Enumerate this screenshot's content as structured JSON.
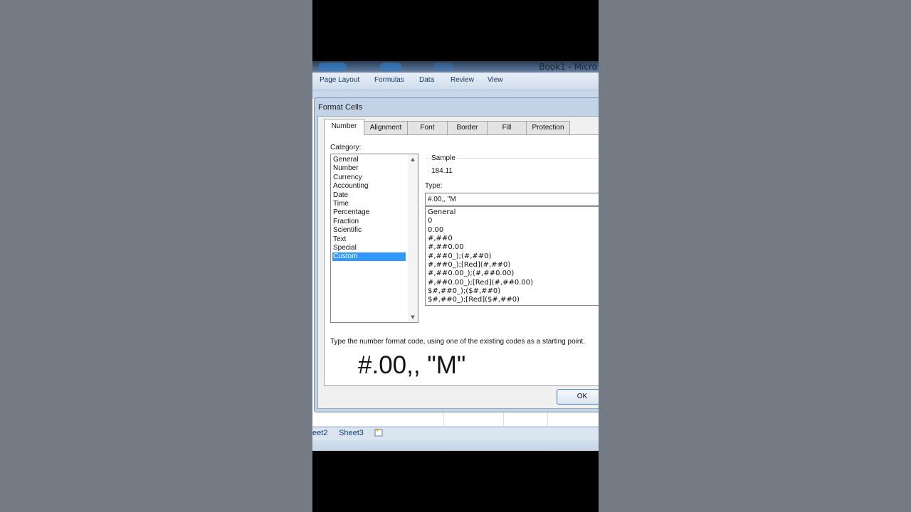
{
  "window": {
    "title": "Book1 - Micro"
  },
  "ribbon": {
    "tabs": [
      "Page Layout",
      "Formulas",
      "Data",
      "Review",
      "View"
    ]
  },
  "sheet_tabs": [
    "eet2",
    "Sheet3"
  ],
  "dialog": {
    "title": "Format Cells",
    "tabs": [
      "Number",
      "Alignment",
      "Font",
      "Border",
      "Fill",
      "Protection"
    ],
    "active_tab": "Number",
    "category_label": "Category:",
    "categories": [
      "General",
      "Number",
      "Currency",
      "Accounting",
      "Date",
      "Time",
      "Percentage",
      "Fraction",
      "Scientific",
      "Text",
      "Special",
      "Custom"
    ],
    "selected_category": "Custom",
    "sample_label": "Sample",
    "sample_value": "184.11",
    "type_label": "Type:",
    "type_value": "#.00,, \"M",
    "type_options": [
      "General",
      "0",
      "0.00",
      "#,##0",
      "#,##0.00",
      "#,##0_);(#,##0)",
      "#,##0_);[Red](#,##0)",
      "#,##0.00_);(#,##0.00)",
      "#,##0.00_);[Red](#,##0.00)",
      "$#,##0_);($#,##0)",
      "$#,##0_);[Red]($#,##0)"
    ],
    "hint": "Type the number format code, using one of the existing codes as a starting point.",
    "ok_label": "OK"
  },
  "overlay_text": "#.00,, \"M\"",
  "colors": {
    "selection": "#3399ff",
    "side_background": "#747b84",
    "dialog_frame": "#c3d3e7"
  }
}
